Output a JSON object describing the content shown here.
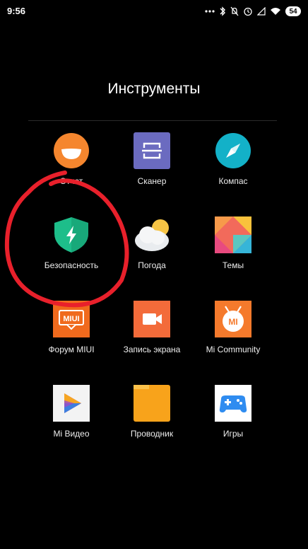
{
  "status_bar": {
    "time": "9:56",
    "battery": "54",
    "icons": [
      "dots-icon",
      "bluetooth-icon",
      "mute-icon",
      "alarm-icon",
      "signal-icon",
      "wifi-icon",
      "battery-icon"
    ]
  },
  "folder": {
    "title": "Инструменты",
    "apps": [
      {
        "label": "Отчет",
        "icon": "report-face-icon",
        "color": "#F5862E"
      },
      {
        "label": "Сканер",
        "icon": "scanner-icon",
        "color": "#6B6BC0"
      },
      {
        "label": "Компас",
        "icon": "compass-icon",
        "color": "#13B1C8"
      },
      {
        "label": "Безопасность",
        "icon": "security-shield-icon",
        "color": "#1DBE8A"
      },
      {
        "label": "Погода",
        "icon": "weather-icon",
        "color": "#F6C445"
      },
      {
        "label": "Темы",
        "icon": "themes-icon",
        "color": "#F26A5B"
      },
      {
        "label": "Форум MIUI",
        "icon": "miui-forum-icon",
        "color": "#F06A1D",
        "icon_text": "MIUI"
      },
      {
        "label": "Запись экрана",
        "icon": "screen-recorder-icon",
        "color": "#F36B3A"
      },
      {
        "label": "Mi Community",
        "icon": "mi-community-icon",
        "color": "#F57A2C",
        "icon_text": "MI"
      },
      {
        "label": "Mi Видео",
        "icon": "mi-video-icon",
        "color": "#F3F3F3"
      },
      {
        "label": "Проводник",
        "icon": "file-manager-icon",
        "color": "#F8A31B"
      },
      {
        "label": "Игры",
        "icon": "games-icon",
        "color": "#2F8CF0"
      }
    ]
  },
  "annotation": {
    "color": "#E8202B"
  }
}
